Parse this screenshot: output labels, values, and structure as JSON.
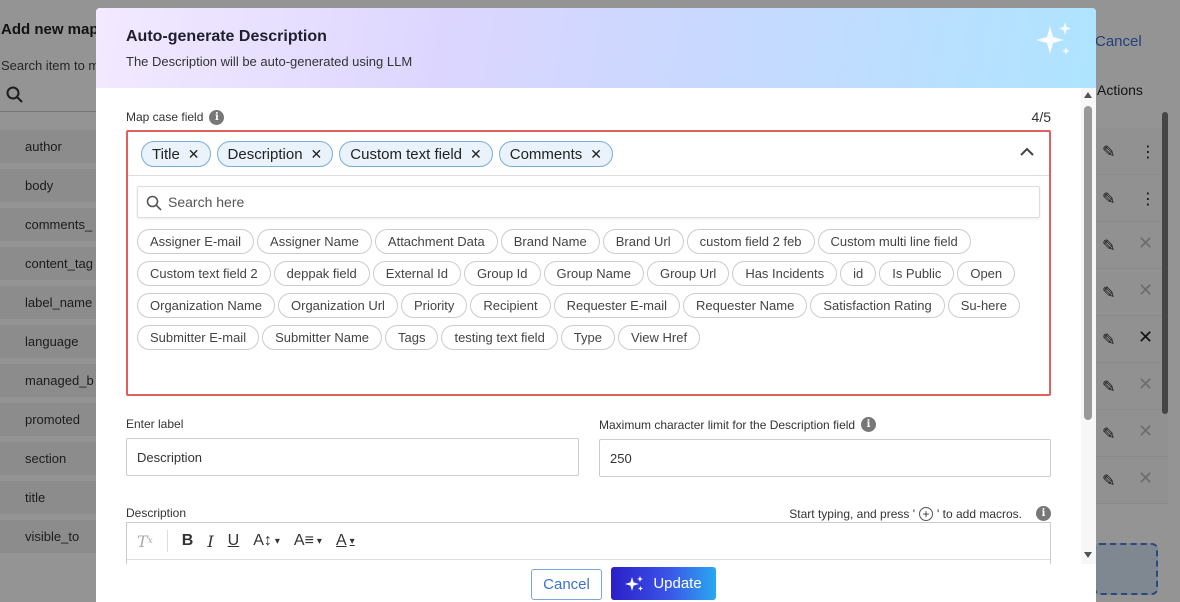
{
  "background": {
    "title": "Add new map",
    "search_hint": "Search item to m",
    "cancel_label": "Cancel",
    "actions_label": "Actions",
    "list": [
      "author",
      "body",
      "comments_",
      "content_tag",
      "label_name",
      "language",
      "managed_b",
      "promoted",
      "section",
      "title",
      "visible_to"
    ]
  },
  "modal": {
    "title": "Auto-generate Description",
    "subtitle": "The Description will be auto-generated using LLM",
    "map_field_label": "Map case field",
    "counter": "4/5",
    "selected": [
      "Title",
      "Description",
      "Custom text field",
      "Comments"
    ],
    "search_placeholder": "Search here",
    "options": [
      "Assigner E-mail",
      "Assigner Name",
      "Attachment Data",
      "Brand Name",
      "Brand Url",
      "custom field 2 feb",
      "Custom multi line field",
      "Custom text field 2",
      "deppak field",
      "External Id",
      "Group Id",
      "Group Name",
      "Group Url",
      "Has Incidents",
      "id",
      "Is Public",
      "Open",
      "Organization Name",
      "Organization Url",
      "Priority",
      "Recipient",
      "Requester E-mail",
      "Requester Name",
      "Satisfaction Rating",
      "Su-here",
      "Submitter E-mail",
      "Submitter Name",
      "Tags",
      "testing text field",
      "Type",
      "View Href"
    ],
    "label_field_label": "Enter label",
    "label_field_value": "Description",
    "limit_field_label": "Maximum character limit for the Description field",
    "limit_field_value": "250",
    "description_label": "Description",
    "macros_hint_pre": "Start typing, and press '",
    "macros_hint_post": "' to add macros.",
    "cancel_label": "Cancel",
    "update_label": "Update"
  },
  "colors": {
    "accent": "#2a1fc7",
    "error_border": "#e06060",
    "chip_border": "#7aaed6"
  }
}
